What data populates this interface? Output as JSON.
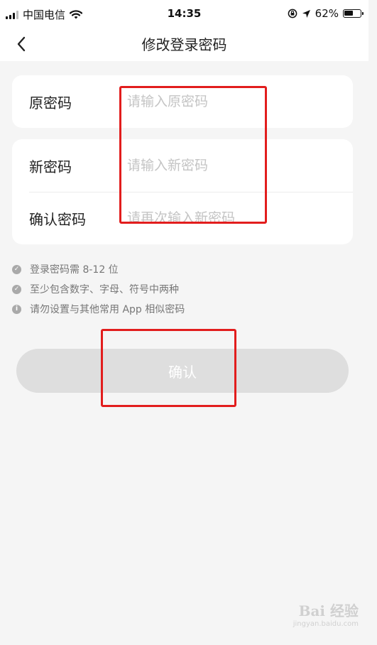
{
  "status_bar": {
    "carrier": "中国电信",
    "time": "14:35",
    "battery_percent": "62%",
    "battery_level": 0.62,
    "icons": [
      "signal-icon",
      "wifi-icon",
      "orientation-lock-icon",
      "location-icon",
      "battery-icon"
    ]
  },
  "header": {
    "title": "修改登录密码",
    "back_icon": "chevron-left-icon"
  },
  "form": {
    "old_password": {
      "label": "原密码",
      "placeholder": "请输入原密码"
    },
    "new_password": {
      "label": "新密码",
      "placeholder": "请输入新密码"
    },
    "confirm_password": {
      "label": "确认密码",
      "placeholder": "请再次输入新密码"
    }
  },
  "tips": [
    {
      "icon": "check-circle-icon",
      "text": "登录密码需 8-12 位"
    },
    {
      "icon": "check-circle-icon",
      "text": "至少包含数字、字母、符号中两种"
    },
    {
      "icon": "info-circle-icon",
      "text": "请勿设置与其他常用 App 相似密码"
    }
  ],
  "confirm_button": {
    "label": "确认"
  },
  "watermark": {
    "main": "Bai 经验",
    "sub": "jingyan.baidu.com"
  },
  "colors": {
    "background": "#f5f5f5",
    "card": "#ffffff",
    "button_disabled": "#dedede",
    "highlight_red": "#e21d1d",
    "placeholder": "#c4c4c4",
    "tip_text": "#777777"
  }
}
